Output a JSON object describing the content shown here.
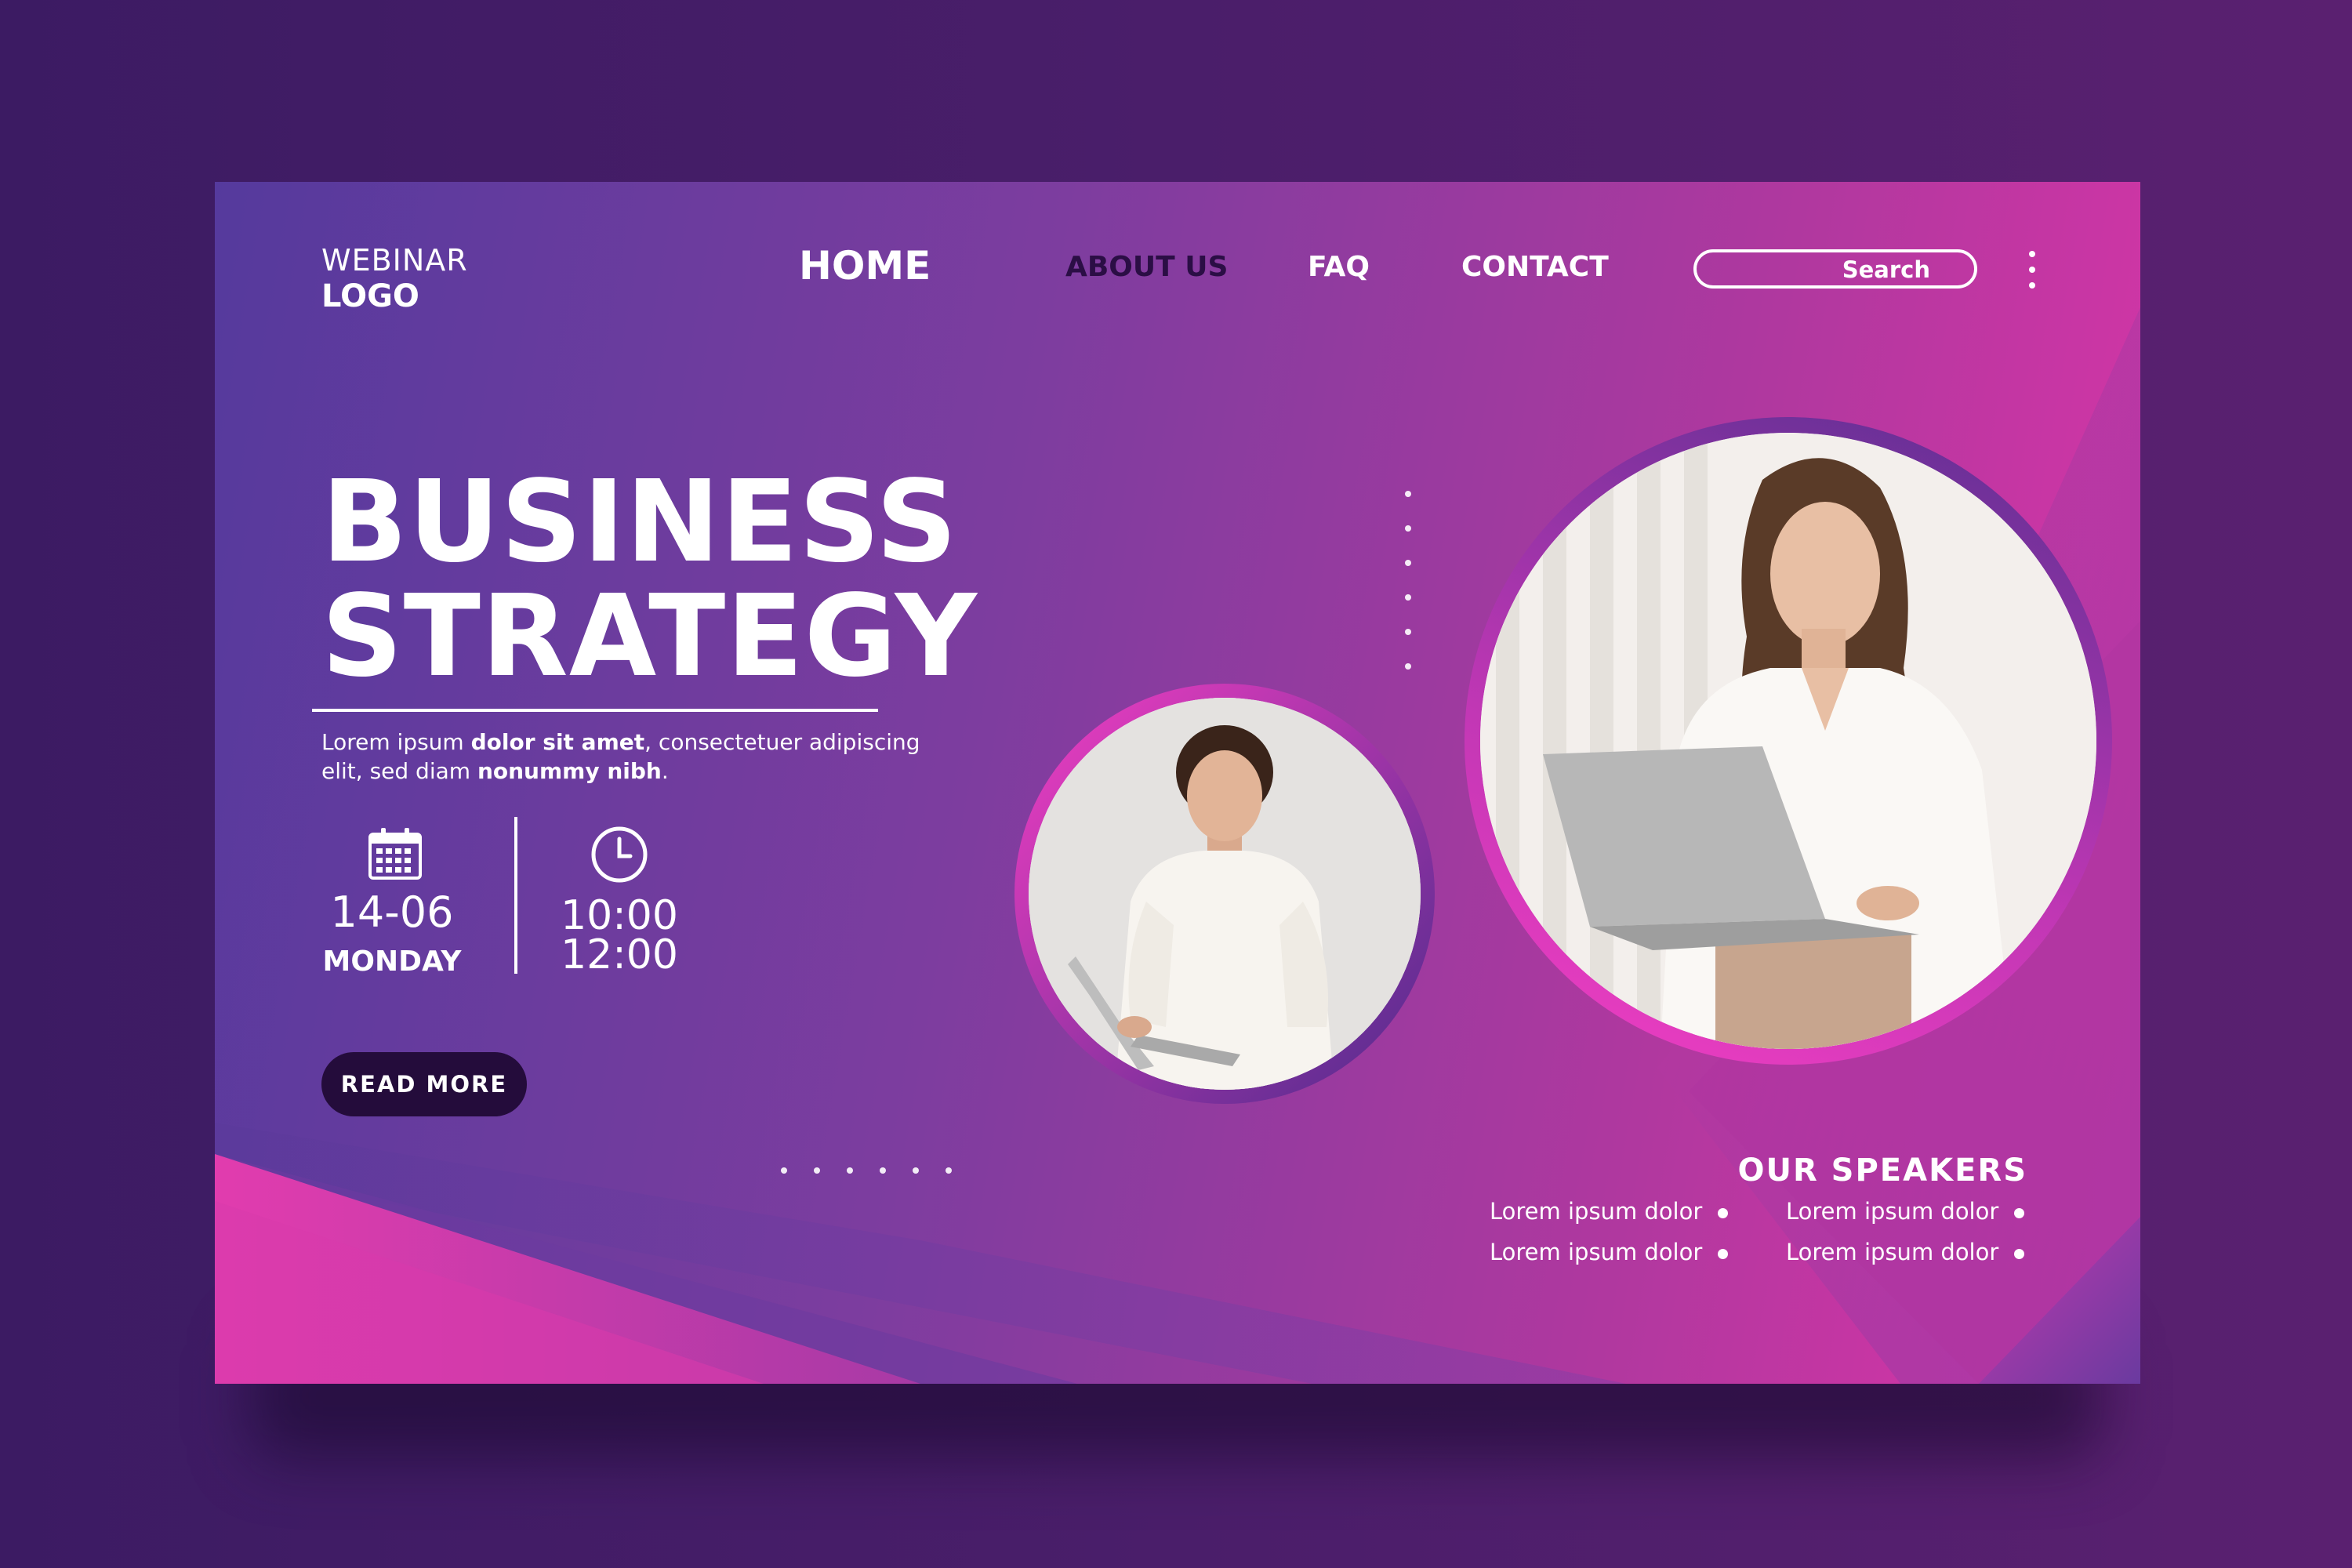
{
  "logo": {
    "line1": "WEBINAR",
    "line2": "LOGO"
  },
  "nav": {
    "home": "HOME",
    "about": "ABOUT US",
    "faq": "FAQ",
    "contact": "CONTACT"
  },
  "search": {
    "label": "Search"
  },
  "hero": {
    "title_line1": "BUSINESS",
    "title_line2": "STRATEGY",
    "desc": {
      "p1": "Lorem ipsum ",
      "b1": "dolor sit amet",
      "p2": ", consectetuer adipiscing elit, sed diam ",
      "b2": "nonummy nibh",
      "p3": "."
    },
    "date": {
      "number": "14-06",
      "day": "MONDAY"
    },
    "time": {
      "start": "10:00",
      "end": "12:00"
    },
    "button": "READ MORE"
  },
  "speakers": {
    "title": "OUR SPEAKERS",
    "items": [
      "Lorem ipsum dolor",
      "Lorem ipsum dolor",
      "Lorem ipsum dolor",
      "Lorem ipsum dolor"
    ]
  },
  "icons": {
    "calendar": "calendar-icon",
    "clock": "clock-icon",
    "menu": "kebab-menu-icon"
  },
  "colors": {
    "accent_pink": "#e935b0",
    "accent_purple": "#553a9d",
    "dark_button": "#240c3b",
    "background": "#3c1b63"
  }
}
